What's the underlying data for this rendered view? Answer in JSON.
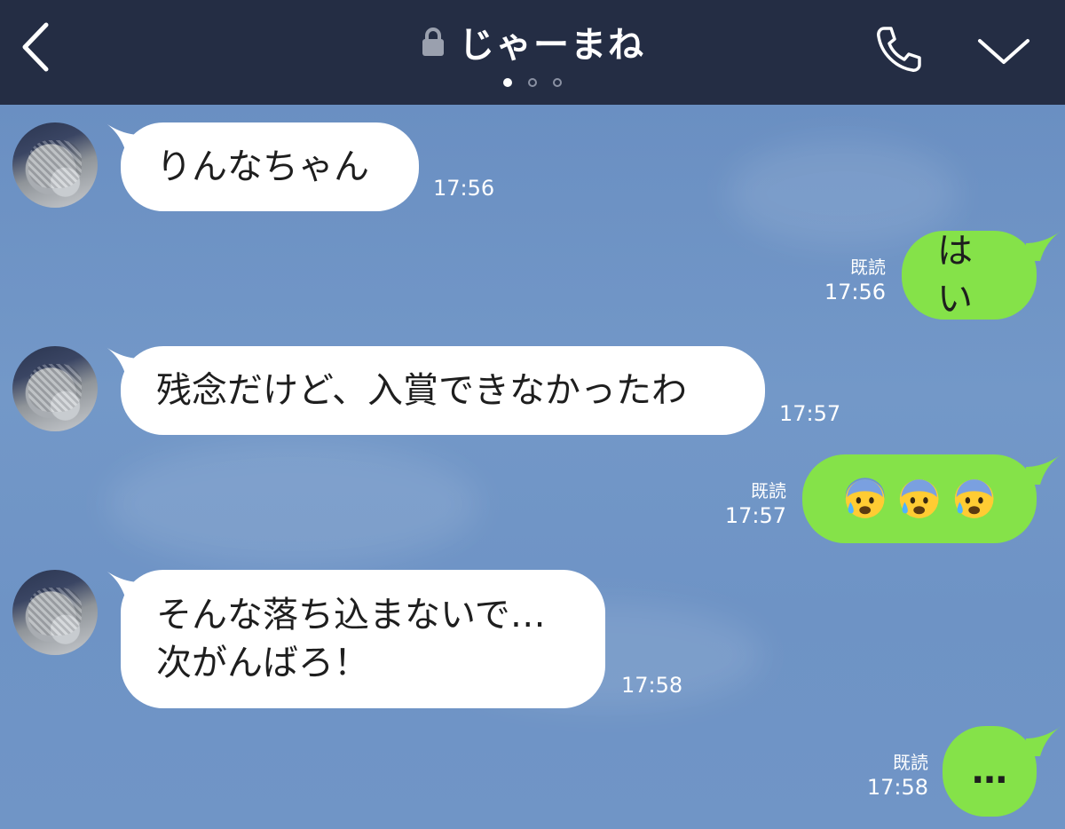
{
  "header": {
    "title": "じゃーまね",
    "page_dots": 3,
    "active_dot": 0,
    "icons": [
      "back-icon",
      "lock-icon",
      "phone-icon",
      "chevron-down-icon"
    ]
  },
  "messages": [
    {
      "side": "left",
      "text": "りんなちゃん",
      "time": "17:56"
    },
    {
      "side": "right",
      "text": "はい",
      "read": "既読",
      "time": "17:56"
    },
    {
      "side": "left",
      "text": "残念だけど、入賞できなかったわ",
      "time": "17:57"
    },
    {
      "side": "right",
      "text": "😰😰😰",
      "read": "既読",
      "time": "17:57"
    },
    {
      "side": "left",
      "text_line1": "そんな落ち込まないで…",
      "text_line2": "次がんばろ！",
      "time": "17:58"
    },
    {
      "side": "right",
      "text": "…",
      "read": "既読",
      "time": "17:58"
    }
  ],
  "colors": {
    "header_bg": "#242d44",
    "chat_bg": "#6f93c4",
    "bubble_left": "#ffffff",
    "bubble_right": "#85e249"
  }
}
